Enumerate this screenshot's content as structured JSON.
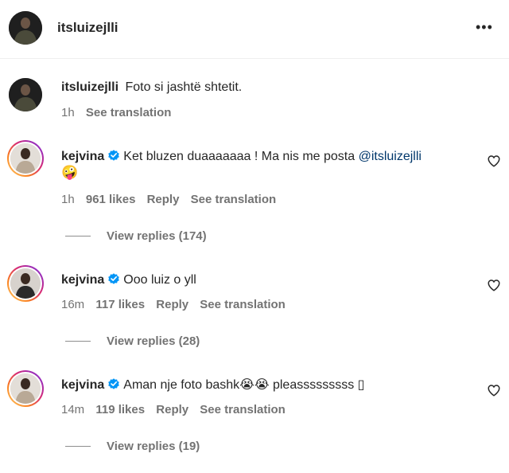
{
  "header": {
    "username": "itsluizejlli",
    "more_label": "•••"
  },
  "caption": {
    "username": "itsluizejlli",
    "text": "Foto si jashtë shtetit.",
    "time": "1h",
    "see_translation": "See translation"
  },
  "comments": [
    {
      "username": "kejvina",
      "text": "Ket bluzen duaaaaaaa ! Ma nis me posta",
      "mention": "@itsluizejlli",
      "emoji_line2": "🤪",
      "time": "1h",
      "likes": "961 likes",
      "reply": "Reply",
      "see_translation": "See translation",
      "view_replies": "View replies (174)"
    },
    {
      "username": "kejvina",
      "text": "Ooo luiz o yll",
      "time": "16m",
      "likes": "117 likes",
      "reply": "Reply",
      "see_translation": "See translation",
      "view_replies": "View replies (28)"
    },
    {
      "username": "kejvina",
      "text": "Aman nje foto bashk",
      "emoji": "😭😭",
      "text_after": " pleasssssssss ▯",
      "time": "14m",
      "likes": "119 likes",
      "reply": "Reply",
      "see_translation": "See translation",
      "view_replies": "View replies (19)"
    }
  ],
  "colors": {
    "verified": "#0095f6",
    "link": "#00376b",
    "meta": "#737373"
  }
}
